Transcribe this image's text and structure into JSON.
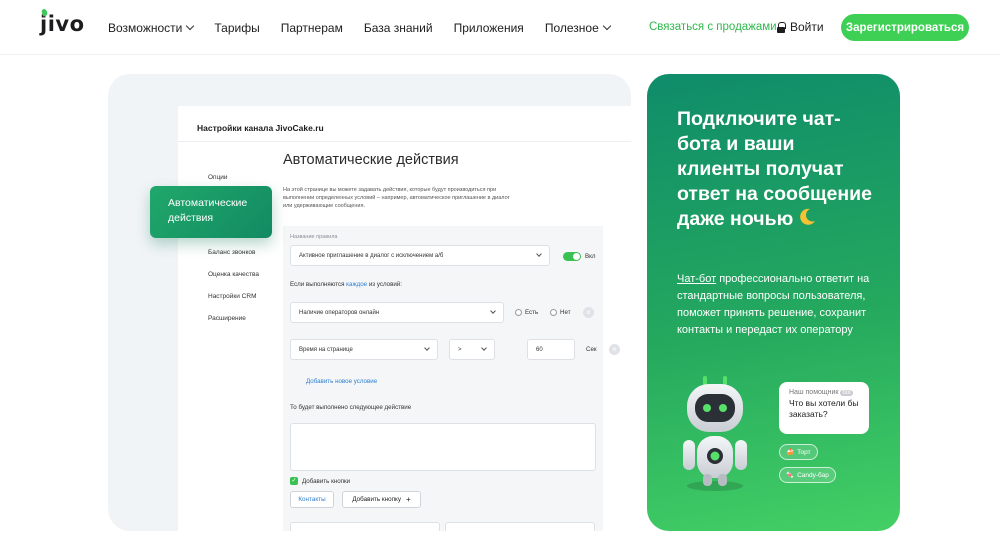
{
  "nav": {
    "logo": "JIVO",
    "items": [
      {
        "label": "Возможности",
        "dropdown": true
      },
      {
        "label": "Тарифы",
        "dropdown": false
      },
      {
        "label": "Партнерам",
        "dropdown": false
      },
      {
        "label": "База знаний",
        "dropdown": false
      },
      {
        "label": "Приложения",
        "dropdown": false
      },
      {
        "label": "Полезное",
        "dropdown": true
      }
    ],
    "contact_sales": "Связаться с продажами",
    "login": "Войти",
    "signup": "Зарегистрироваться"
  },
  "settings": {
    "title": "Настройки канала JivoCake.ru",
    "sidebar": [
      "Опции",
      "Баланс звонков",
      "Оценка качества",
      "Настройки CRM",
      "Расширение"
    ],
    "active_chip": "Автоматические действия",
    "heading": "Автоматические действия",
    "description": "На этой странице вы можете задавать действия, которые будут производиться при выполнении определенных условий – например, автоматическое приглашение в диалог или удерживающие сообщения.",
    "rule_name_label": "Название правила",
    "rule_name_value": "Активное приглашение в диалог с исключением а/б",
    "toggle_label": "Вкл",
    "conditions_prefix": "Если выполняются",
    "conditions_link": "каждое",
    "conditions_suffix": "из условий:",
    "condition1": "Наличие операторов онлайн",
    "yes": "Есть",
    "no": "Нет",
    "condition2": "Время на странице",
    "operator": ">",
    "seconds_value": "60",
    "seconds_unit": "Сек",
    "add_condition": "Добавить новое условие",
    "action_label": "То будет выполнено следующее действие",
    "add_buttons": "Добавить кнопки",
    "contacts_button": "Контакты",
    "add_button": "Добавить кнопку"
  },
  "promo": {
    "title": "Подключите чат-бота и ваши клиенты получат ответ на сообщение даже ночью",
    "text_link": "Чат-бот",
    "text": "профессионально ответит на стандартные вопросы пользователя, поможет принять решение, сохранит контакты и передаст их оператору",
    "bubble_from": "Наш помощник",
    "bubble_badge": "bot",
    "bubble_question": "Что вы хотели бы заказать?",
    "option1": "Торт",
    "option2": "Candy-бар"
  },
  "colors": {
    "accent_green": "#3ed054",
    "promo_gradient_start": "#0f8c6a",
    "promo_gradient_end": "#44d065",
    "link_blue": "#2f7fd1"
  }
}
